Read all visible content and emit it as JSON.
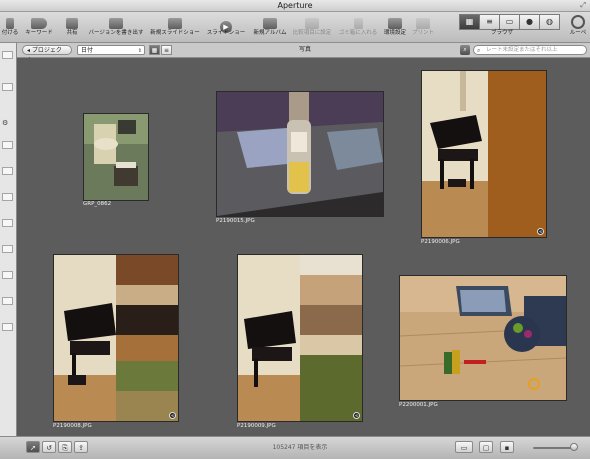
{
  "app": {
    "title": "Aperture"
  },
  "toolbar": {
    "cut_label": "付ける",
    "keyword_label": "キーワード",
    "share_label": "共有",
    "write_version_label": "バージョンを書き出す",
    "new_slideshow_label": "新規スライドショー",
    "slideshow_label": "スライドショー",
    "new_album_label": "新規アルバム",
    "compare_label": "比較項目に設定",
    "trash_label": "ゴミ箱に入れる",
    "prefs_label": "環境設定",
    "print_label": "プリント",
    "browser_label": "ブラウザ",
    "loupe_label": "ルーペ"
  },
  "filterbar": {
    "project_button": "プロジェクト",
    "sort_value": "日付",
    "center_label": "写真",
    "search_placeholder": "レート未設定またはそれ以上"
  },
  "photos": [
    {
      "caption": "GRP_0862"
    },
    {
      "caption": "P2190015.JPG"
    },
    {
      "caption": "P2190006.JPG"
    },
    {
      "caption": "P2190008.JPG"
    },
    {
      "caption": "P2190009.JPG"
    },
    {
      "caption": "P2200001.JPG"
    }
  ],
  "status": {
    "count_text": "105247 項目を表示"
  },
  "colors": {
    "browser_bg": "#5c5c5c",
    "toolbar_bg": "#c8c8c8"
  }
}
